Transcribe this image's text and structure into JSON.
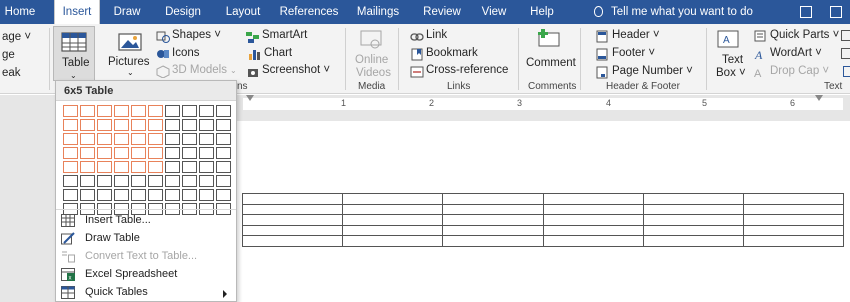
{
  "tabs": [
    "Home",
    "Insert",
    "Draw",
    "Design",
    "Layout",
    "References",
    "Mailings",
    "Review",
    "View",
    "Help"
  ],
  "active_tab": "Insert",
  "tell_me": "Tell me what you want to do",
  "ribbon": {
    "pages_partial": [
      "age ˅",
      "ge",
      "eak"
    ],
    "table": "Table",
    "pictures": "Pictures",
    "shapes": "Shapes ˅",
    "icons": "Icons",
    "models_3d": "3D Models",
    "smartart": "SmartArt",
    "chart": "Chart",
    "screenshot": "Screenshot ˅",
    "online_videos_1": "Online",
    "online_videos_2": "Videos",
    "link": "Link",
    "bookmark": "Bookmark",
    "cross_reference": "Cross-reference",
    "comment": "Comment",
    "header": "Header ˅",
    "footer": "Footer ˅",
    "page_number": "Page Number ˅",
    "text_box_1": "Text",
    "text_box_2": "Box ˅",
    "quick_parts": "Quick Parts ˅",
    "wordart": "WordArt ˅",
    "drop_cap": "Drop Cap ˅",
    "groups": {
      "illustrations_partial": "ns",
      "media": "Media",
      "links": "Links",
      "comments": "Comments",
      "header_footer": "Header & Footer",
      "text": "Text"
    }
  },
  "ruler": {
    "numbers": [
      "1",
      "2",
      "3",
      "4",
      "5",
      "6"
    ]
  },
  "dropdown": {
    "title": "6x5 Table",
    "grid": {
      "cols": 10,
      "rows": 8,
      "selected_cols": 6,
      "selected_rows": 5
    },
    "items": [
      {
        "label": "Insert Table...",
        "icon": "table-grid-icon",
        "disabled": false
      },
      {
        "label": "Draw Table",
        "icon": "pencil-icon",
        "disabled": false
      },
      {
        "label": "Convert Text to Table...",
        "icon": "convert-icon",
        "disabled": true
      },
      {
        "label": "Excel Spreadsheet",
        "icon": "excel-icon",
        "disabled": false
      },
      {
        "label": "Quick Tables",
        "icon": "quick-tables-icon",
        "disabled": false,
        "submenu": true
      }
    ]
  },
  "document_table": {
    "rows": 5,
    "cols": 6
  },
  "colors": {
    "tabbar": "#2b579a",
    "ribbon": "#f3f3f3",
    "grid_highlight": "#e8825a",
    "accent": "#2b579a"
  }
}
